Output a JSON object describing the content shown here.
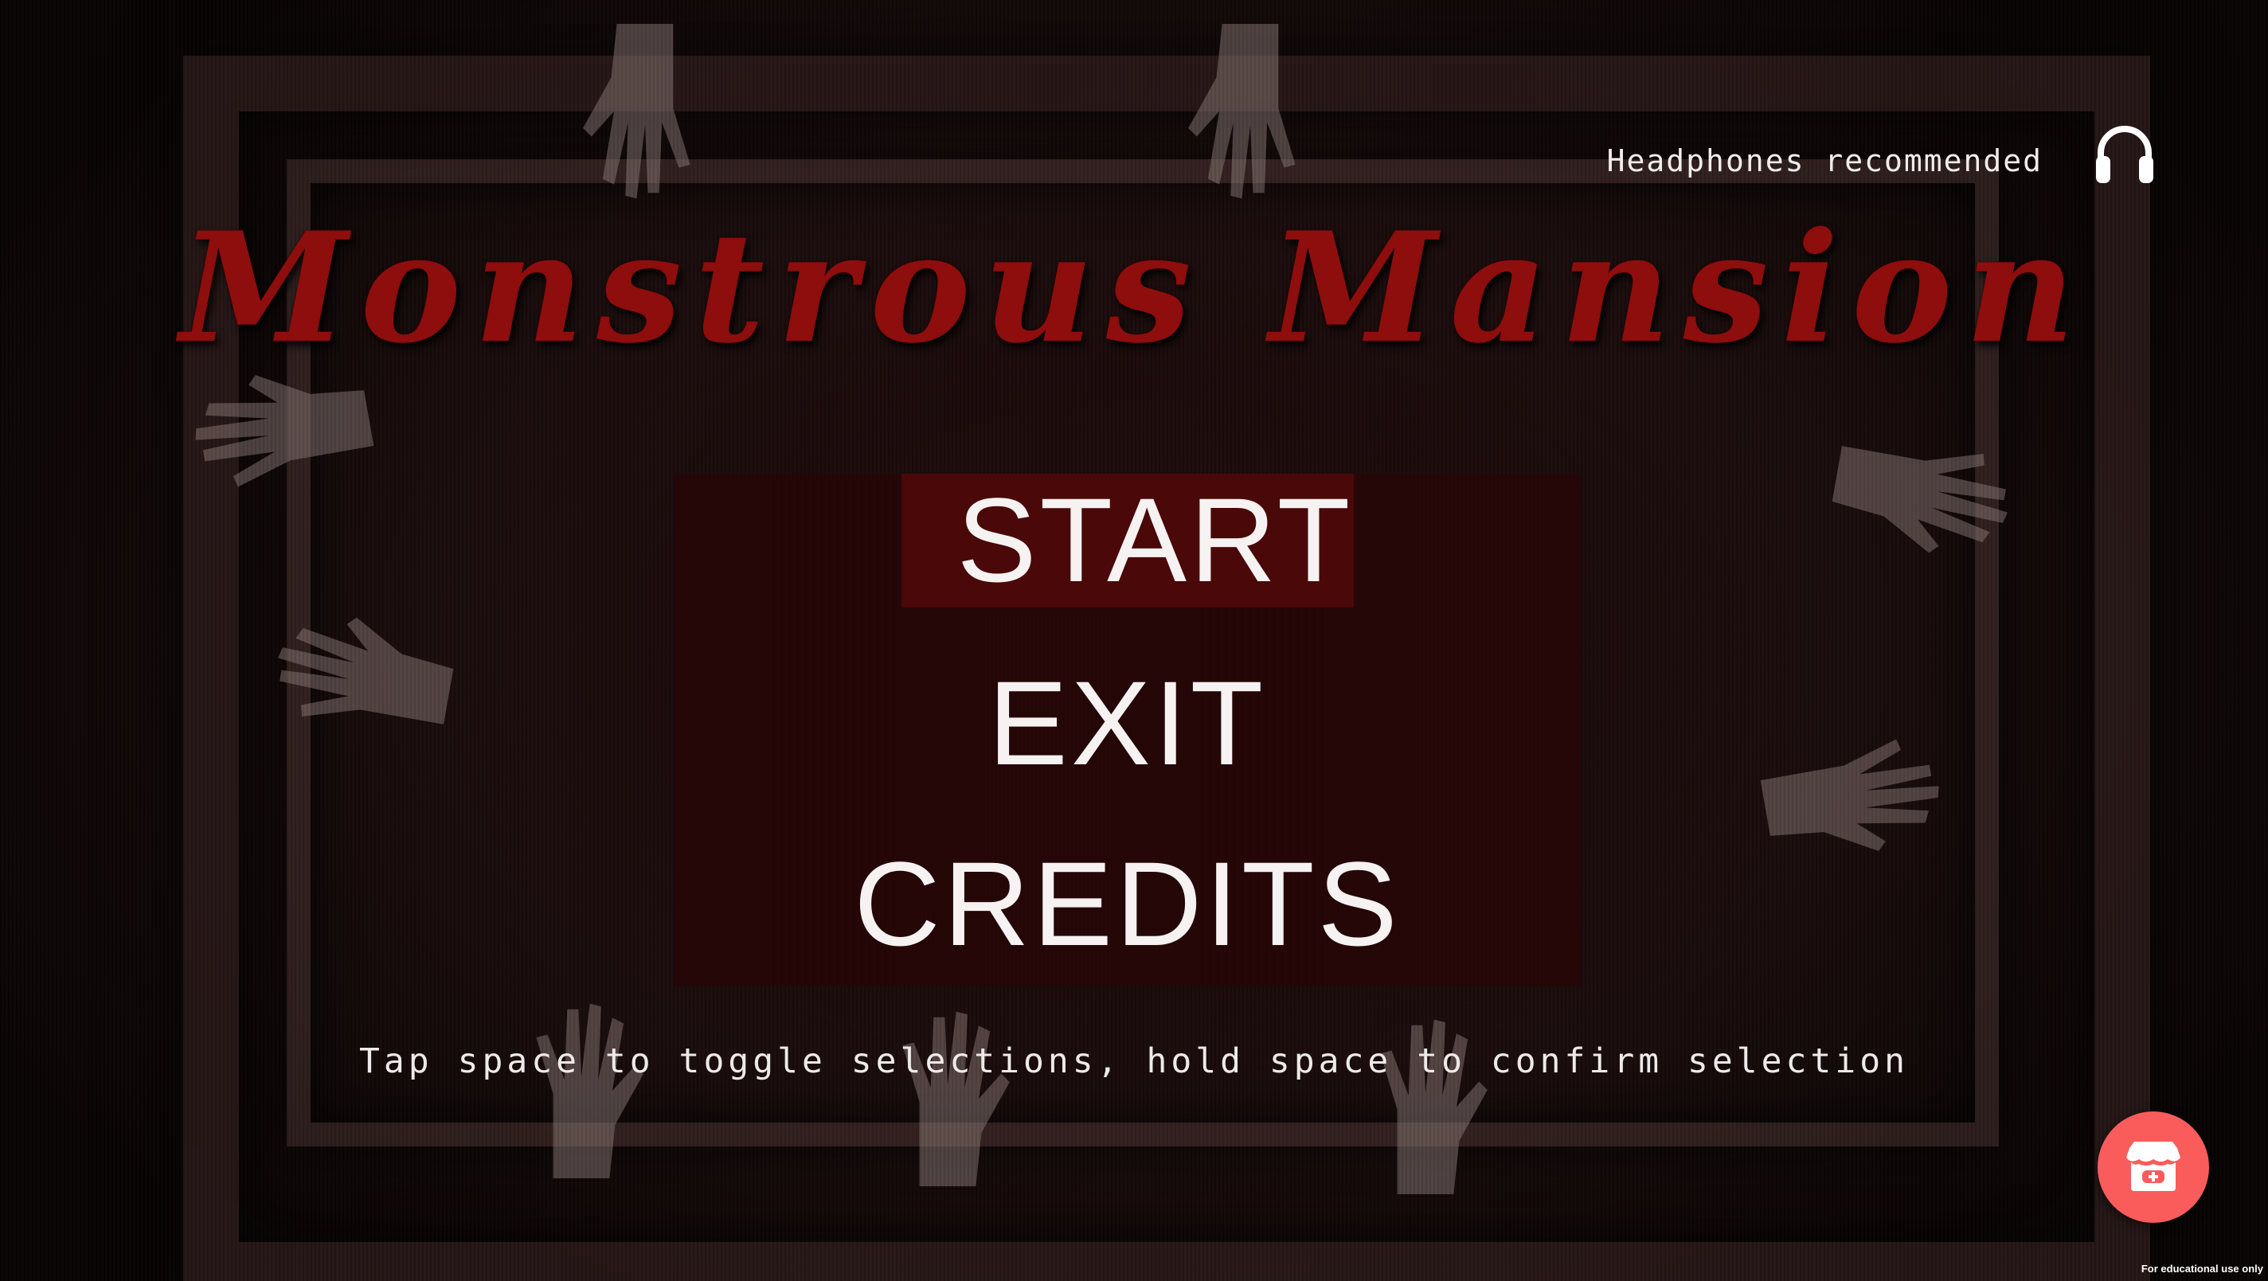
{
  "header": {
    "headphones_text": "Headphones recommended",
    "headphones_icon": "headphones-icon"
  },
  "title": "Monstrous Mansion",
  "menu": {
    "items": [
      {
        "label": "START",
        "selected": true
      },
      {
        "label": "EXIT",
        "selected": false
      },
      {
        "label": "CREDITS",
        "selected": false
      }
    ]
  },
  "hint": "Tap space to toggle selections, hold space to confirm selection",
  "itch_button": {
    "icon": "itch-io-store-icon",
    "color": "#fa5c5c"
  },
  "footer_note": "For educational use only",
  "colors": {
    "title": "#8e0d0d",
    "panel": "#260606",
    "selected_item": "#4a0808",
    "text": "#f6f2f2"
  }
}
